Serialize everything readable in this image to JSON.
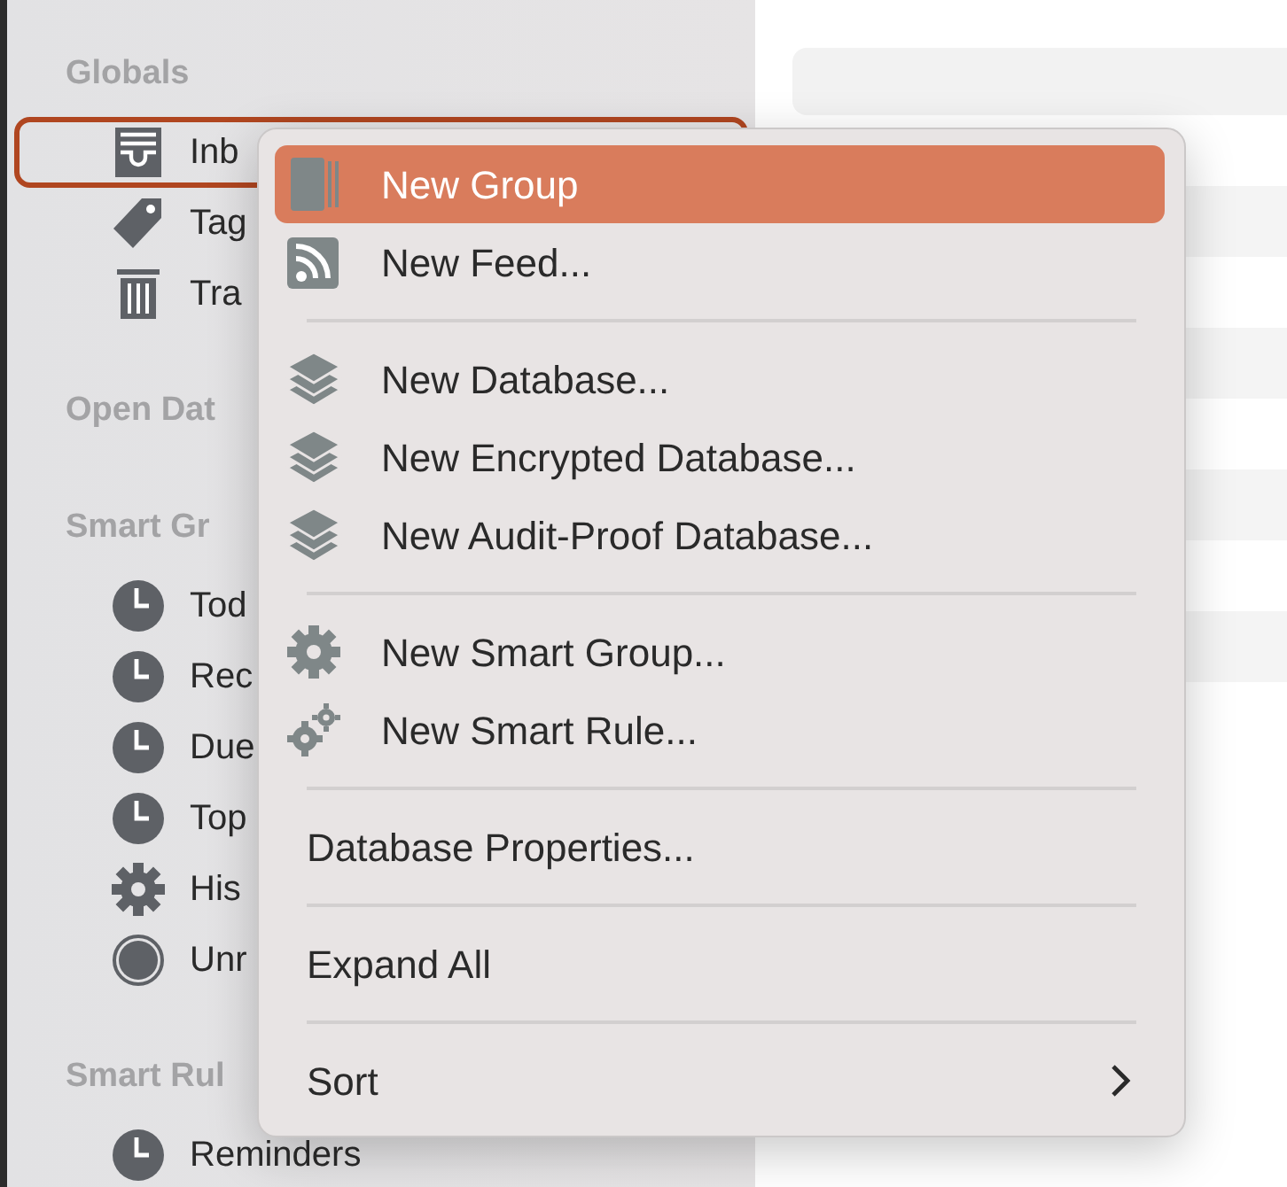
{
  "sidebar": {
    "sections": [
      {
        "heading": "Globals",
        "items": [
          {
            "label": "Inb",
            "kind": "inbox",
            "selected": true
          },
          {
            "label": "Tag",
            "kind": "tag",
            "selected": false
          },
          {
            "label": "Tra",
            "kind": "trash",
            "selected": false
          }
        ]
      },
      {
        "heading": "Open Dat"
      },
      {
        "heading": "Smart Gr",
        "items": [
          {
            "label": "Tod",
            "kind": "clock",
            "selected": false
          },
          {
            "label": "Rec",
            "kind": "clock",
            "selected": false
          },
          {
            "label": "Due",
            "kind": "clock",
            "selected": false
          },
          {
            "label": "Top",
            "kind": "clock",
            "selected": false
          },
          {
            "label": "His",
            "kind": "gear",
            "selected": false
          },
          {
            "label": "Unr",
            "kind": "circle",
            "selected": false
          }
        ]
      },
      {
        "heading": "Smart Rul",
        "items": [
          {
            "label": "Reminders",
            "kind": "clock",
            "selected": false
          }
        ]
      }
    ]
  },
  "context_menu": {
    "items": [
      {
        "kind": "group",
        "label": "New Group",
        "selected": true
      },
      {
        "kind": "feed",
        "label": "New Feed...",
        "selected": false
      },
      {
        "kind": "separator"
      },
      {
        "kind": "layers",
        "label": "New Database...",
        "selected": false
      },
      {
        "kind": "layers",
        "label": "New Encrypted Database...",
        "selected": false
      },
      {
        "kind": "layers",
        "label": "New Audit-Proof Database...",
        "selected": false
      },
      {
        "kind": "separator"
      },
      {
        "kind": "gear",
        "label": "New Smart Group...",
        "selected": false
      },
      {
        "kind": "gears",
        "label": "New Smart Rule...",
        "selected": false
      },
      {
        "kind": "separator"
      },
      {
        "kind": "plain",
        "label": "Database Properties...",
        "selected": false
      },
      {
        "kind": "separator"
      },
      {
        "kind": "plain",
        "label": "Expand All",
        "selected": false
      },
      {
        "kind": "separator"
      },
      {
        "kind": "plain",
        "label": "Sort",
        "selected": false,
        "submenu": true
      }
    ]
  }
}
